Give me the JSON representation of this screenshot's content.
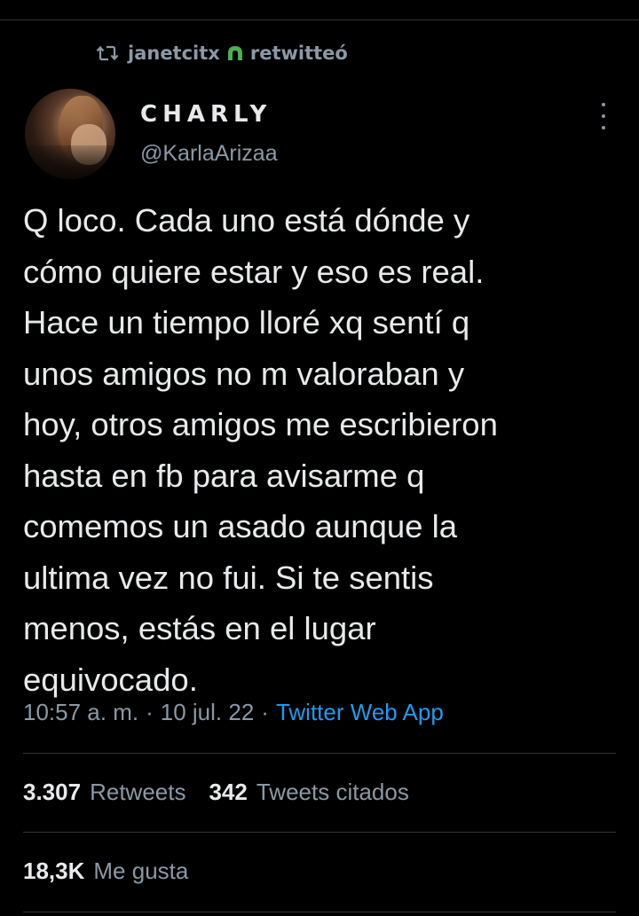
{
  "retweet": {
    "icon": "retweet-icon",
    "user": "janetcitx",
    "badge_icon": "green-emoji-icon",
    "action": "retwitteó"
  },
  "author": {
    "display_name": "CHARLY",
    "handle": "@KarlaArizaa",
    "avatar": "profile-photo"
  },
  "menu": {
    "icon": "more-vertical-icon"
  },
  "tweet": {
    "text": "Q loco. Cada uno está dónde y\ncómo quiere estar y eso es real.\nHace un tiempo lloré xq sentí q\nunos amigos no m valoraban y\nhoy, otros amigos me escribieron\nhasta en fb para avisarme q\ncomemos un asado aunque la\nultima vez no fui. Si te sentis\nmenos, estás en el lugar\nequivocado."
  },
  "meta": {
    "time": "10:57 a. m.",
    "sep1": "·",
    "date": "10 jul. 22",
    "sep2": "·",
    "source": "Twitter Web App"
  },
  "stats": {
    "retweets_count": "3.307",
    "retweets_label": "Retweets",
    "quotes_count": "342",
    "quotes_label": "Tweets citados",
    "likes_count": "18,3K",
    "likes_label": "Me gusta"
  },
  "colors": {
    "background": "#000000",
    "text": "#e7e9ea",
    "secondary": "#8b98a5",
    "link": "#1d9bf0",
    "divider": "#2f3336",
    "badge": "#4caf50"
  }
}
